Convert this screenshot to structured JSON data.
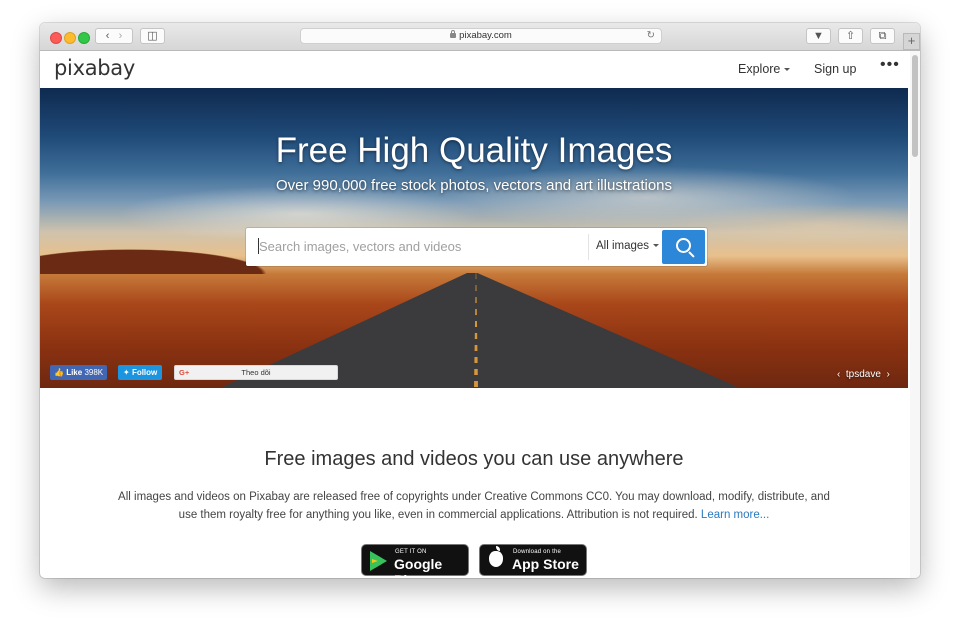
{
  "browser": {
    "url": "pixabay.com",
    "new_tab": "+"
  },
  "header": {
    "logo": "pixabay",
    "explore": "Explore",
    "signup": "Sign up",
    "more": "•••"
  },
  "hero": {
    "title": "Free High Quality Images",
    "subtitle": "Over 990,000 free stock photos, vectors and art illustrations",
    "search_placeholder": "Search images, vectors and videos",
    "search_type": "All images",
    "credit": "tpsdave"
  },
  "social": {
    "fb_like": "Like",
    "fb_count": "398K",
    "twitter_follow": "Follow",
    "gplus_follow": "Theo dõi"
  },
  "main": {
    "headline": "Free images and videos you can use anywhere",
    "description": "All images and videos on Pixabay are released free of copyrights under Creative Commons CC0. You may download, modify, distribute, and use them royalty free for anything you like, even in commercial applications. Attribution is not required.",
    "learn_more": "Learn more...",
    "google_play_small": "GET IT ON",
    "google_play_big": "Google Play",
    "app_store_small": "Download on the",
    "app_store_big": "App Store"
  }
}
